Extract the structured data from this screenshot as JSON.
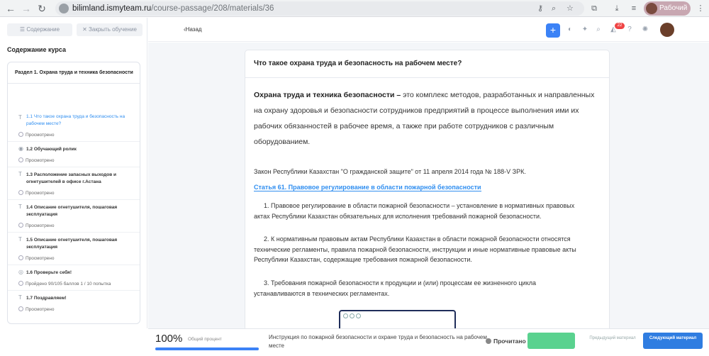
{
  "browser": {
    "url_host": "bilimland.ismyteam.ru",
    "url_path": "/course-passage/208/materials/36",
    "profile_name": "Рабочий"
  },
  "sidebar": {
    "contents_button": "Содержание",
    "close_button": "Закрыть обучение",
    "heading": "Содержание курса",
    "section_title": "Раздел 1. Охрана труда и техника безопасности",
    "lessons": [
      {
        "title": "1.1 Что такое охрана труда и безопасность на рабочем месте?",
        "status": "Просмотрено",
        "type_icon": "T"
      },
      {
        "title": "1.2 Обучающий ролик",
        "status": "Просмотрено",
        "type_icon": "video-icon"
      },
      {
        "title": "1.3 Расположение запасных выходов и огнетушителей в офисе г.Астана",
        "status": "Просмотрено",
        "type_icon": "T"
      },
      {
        "title": "1.4 Описание огнетушителя, пошаговая эксплуатация",
        "status": "Просмотрено",
        "type_icon": "T"
      },
      {
        "title": "1.5 Описание огнетушителя, пошаговая эксплуатация",
        "status": "Просмотрено",
        "type_icon": "T"
      },
      {
        "title": "1.6 Проверьте себя!",
        "status": "Пройдено 90/105 баллов 1 / 10 попытка",
        "type_icon": "quiz-icon"
      },
      {
        "title": "1.7 Поздравляем!",
        "status": "Просмотрено",
        "type_icon": "T"
      }
    ]
  },
  "topbar": {
    "back_label": "Назад",
    "notifications_count": "22"
  },
  "material": {
    "title": "Что такое охрана труда и безопасность на рабочем месте?",
    "intro_bold": "Охрана труда и техника безопасности –",
    "intro_rest": " это комплекс методов, разработанных и направленных на охрану здоровья и безопасности сотрудников предприятий в процессе выполнения ими их рабочих обязанностей в рабочее время, а также при работе сотрудников с различным оборудованием.",
    "law_line": "Закон Республики Казахстан \"О гражданской защите\" от 11 апреля 2014 года № 188-V ЗРК.",
    "article_link": "Статья 61. Правовое регулирование в области пожарной безопасности",
    "paragraphs": [
      "1. Правовое регулирование в области пожарной безопасности – установление в нормативных правовых актах Республики Казахстан обязательных для исполнения требований пожарной безопасности.",
      "2. К нормативным правовым актам Республики Казахстан в области пожарной безопасности относятся технические регламенты, правила пожарной безопасности, инструкции и иные нормативные правовые акты Республики Казахстан, содержащие требования пожарной безопасности.",
      "3. Требования пожарной безопасности к продукции и (или) процессам ее жизненного цикла устанавливаются в технических регламентах."
    ]
  },
  "bottombar": {
    "percent": "100%",
    "percent_label": "Общий процент",
    "progress_fraction": 1.0,
    "next_material_title": "Инструкция по пожарной безопасности и охране труда и безопасность на рабочем месте",
    "read_status": "Прочитано",
    "prev_button": "Предыдущий материал",
    "next_button": "Следующий материал"
  },
  "colors": {
    "accent": "#3b82f6",
    "link": "#2f8ef0",
    "success": "#5ad28f",
    "badge": "#ef4444"
  }
}
